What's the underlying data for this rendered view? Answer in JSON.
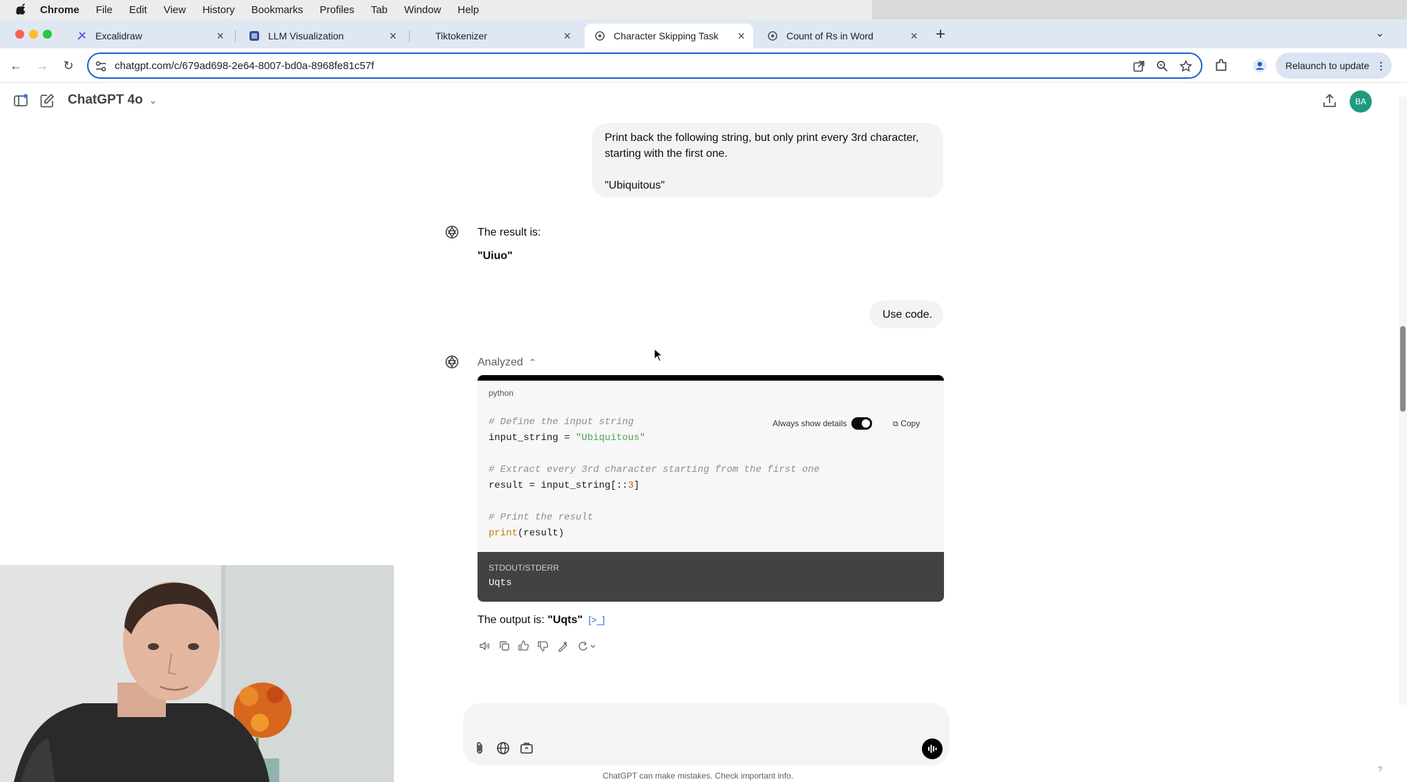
{
  "menubar": {
    "app": "Chrome",
    "items": [
      "File",
      "Edit",
      "View",
      "History",
      "Bookmarks",
      "Profiles",
      "Tab",
      "Window",
      "Help"
    ]
  },
  "tabs": [
    {
      "title": "Excalidraw",
      "active": false
    },
    {
      "title": "LLM Visualization",
      "active": false
    },
    {
      "title": "Tiktokenizer",
      "active": false
    },
    {
      "title": "Character Skipping Task",
      "active": true
    },
    {
      "title": "Count of Rs in Word",
      "active": false
    }
  ],
  "toolbar": {
    "url": "chatgpt.com/c/679ad698-2e64-8007-bd0a-8968fe81c57f",
    "relaunch_label": "Relaunch to update"
  },
  "header": {
    "model": "ChatGPT 4o",
    "avatar_initials": "BA"
  },
  "conversation": {
    "user1": {
      "line1": "Print back the following string, but only print every 3rd character,",
      "line2": "starting with the first one.",
      "line3": "\"Ubiquitous\""
    },
    "assistant1": {
      "intro": "The result is:",
      "result": "\"Uiuo\""
    },
    "user2": "Use code.",
    "assistant2": {
      "analyzed_label": "Analyzed",
      "code_lang": "python",
      "always_show_details": "Always show details",
      "copy_label": "Copy",
      "code": {
        "c1": "# Define the input string",
        "l2a": "input_string = ",
        "l2b": "\"Ubiquitous\"",
        "c3": "# Extract every 3rd character starting from the first one",
        "l4a": "result = input_string[::",
        "l4b": "3",
        "l4c": "]",
        "c5": "# Print the result",
        "l6a": "print",
        "l6b": "(result)"
      },
      "stdout_label": "STDOUT/STDERR",
      "stdout_value": "Uqts",
      "output_prefix": "The output is: ",
      "output_value": "\"Uqts\""
    }
  },
  "footer": {
    "disclaimer": "ChatGPT can make mistakes. Check important info.",
    "help": "?"
  },
  "colors": {
    "accent_blue": "#1a5fd1",
    "avatar_bg": "#1f9a7f",
    "tab_strip": "#dfe7f3"
  }
}
